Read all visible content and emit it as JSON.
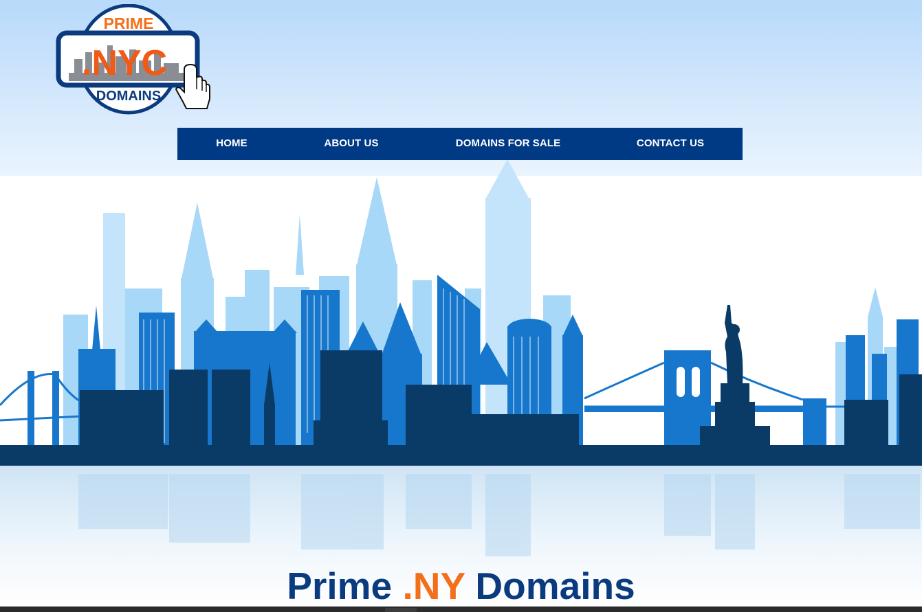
{
  "logo": {
    "top_text": "PRIME",
    "main_text": ".NYC",
    "bottom_text": "DOMAINS",
    "icon": "hand-pointer-icon"
  },
  "nav": {
    "items": [
      {
        "label": "HOME"
      },
      {
        "label": "ABOUT US"
      },
      {
        "label": "DOMAINS FOR SALE"
      },
      {
        "label": "CONTACT US"
      }
    ]
  },
  "hero": {
    "image": "new-york-skyline-illustration"
  },
  "headline": {
    "part1": "Prime ",
    "part2": ".NY",
    "part3": " Domains"
  },
  "colors": {
    "nav_bg": "#003a85",
    "brand_blue": "#0b3b7f",
    "brand_orange": "#f36f1a",
    "skyline_dark": "#0a3a66",
    "skyline_mid": "#1677cc",
    "skyline_light": "#a8d8f8"
  }
}
